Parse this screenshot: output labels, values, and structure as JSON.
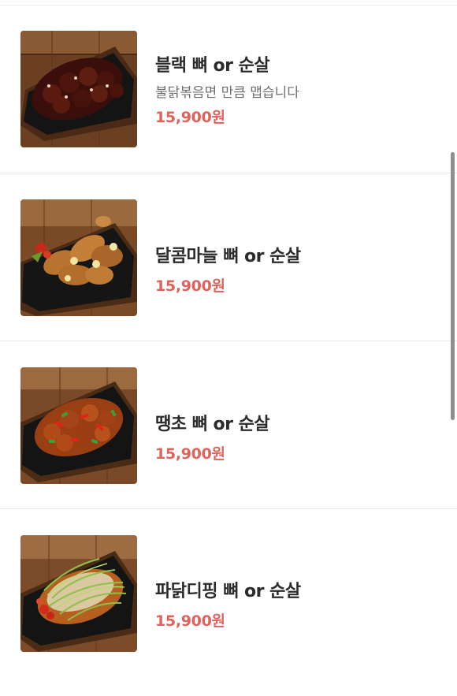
{
  "menu": {
    "items": [
      {
        "name": "블랙 뼈 or 순살",
        "description": "불닭볶음면 만큼 맵습니다",
        "price": "15,900원",
        "image_icon": "black-spicy-chicken-photo"
      },
      {
        "name": "달콤마늘 뼈 or 순살",
        "description": "",
        "price": "15,900원",
        "image_icon": "sweet-garlic-chicken-photo"
      },
      {
        "name": "땡초 뼈 or 순살",
        "description": "",
        "price": "15,900원",
        "image_icon": "hot-pepper-chicken-photo"
      },
      {
        "name": "파닭디핑 뼈 or 순살",
        "description": "",
        "price": "15,900원",
        "image_icon": "green-onion-dipping-chicken-photo"
      }
    ]
  },
  "colors": {
    "price": "#e0625a",
    "name": "#2b2b2b",
    "description": "#6e6e6e"
  }
}
